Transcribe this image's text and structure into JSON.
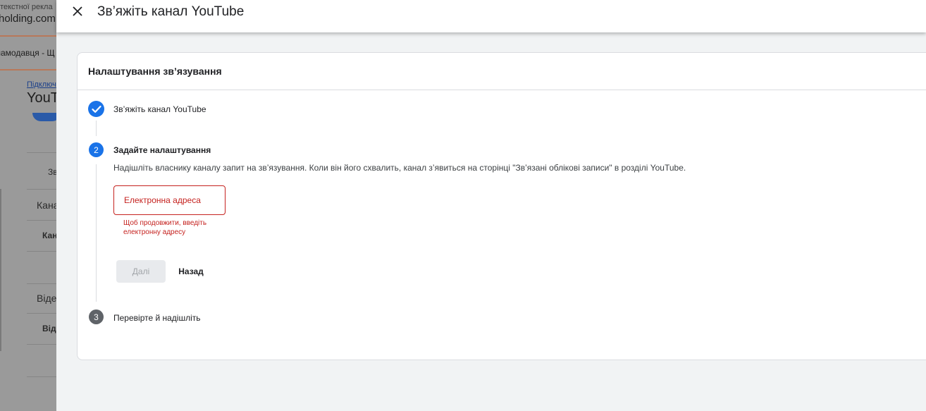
{
  "background": {
    "account_label": "нтекстної рекла",
    "account_name": "holding.com",
    "row2_text": "ламодавця - Щ",
    "link_text": "Підключ",
    "heading": "YouT",
    "table_cells": [
      "Зв",
      "Кана",
      "Кан",
      "",
      "Віде",
      "Від",
      ""
    ]
  },
  "panel": {
    "title": "Зв’яжіть канал YouTube",
    "close_icon": "close-icon"
  },
  "card": {
    "title": "Налаштування зв’язування",
    "steps": [
      {
        "number": "",
        "label": "Зв’яжіть канал YouTube",
        "status": "completed",
        "icon": "check-icon"
      },
      {
        "number": "2",
        "label": "Задайте налаштування",
        "status": "active"
      },
      {
        "number": "3",
        "label": "Перевірте й надішліть",
        "status": "pending"
      }
    ],
    "description": "Надішліть власнику каналу запит на зв’язування. Коли він його схвалить, канал з’явиться на сторінці \"Зв’язані облікові записи\" в розділі YouTube.",
    "email": {
      "placeholder": "Електронна адреса",
      "value": "",
      "error": "Щоб продовжити, введіть електронну адресу"
    },
    "buttons": {
      "next": "Далі",
      "back": "Назад"
    }
  },
  "colors": {
    "primary": "#1a73e8",
    "error": "#c5221f",
    "pending": "#5f6368",
    "panel_bg": "#f1f3f4"
  }
}
